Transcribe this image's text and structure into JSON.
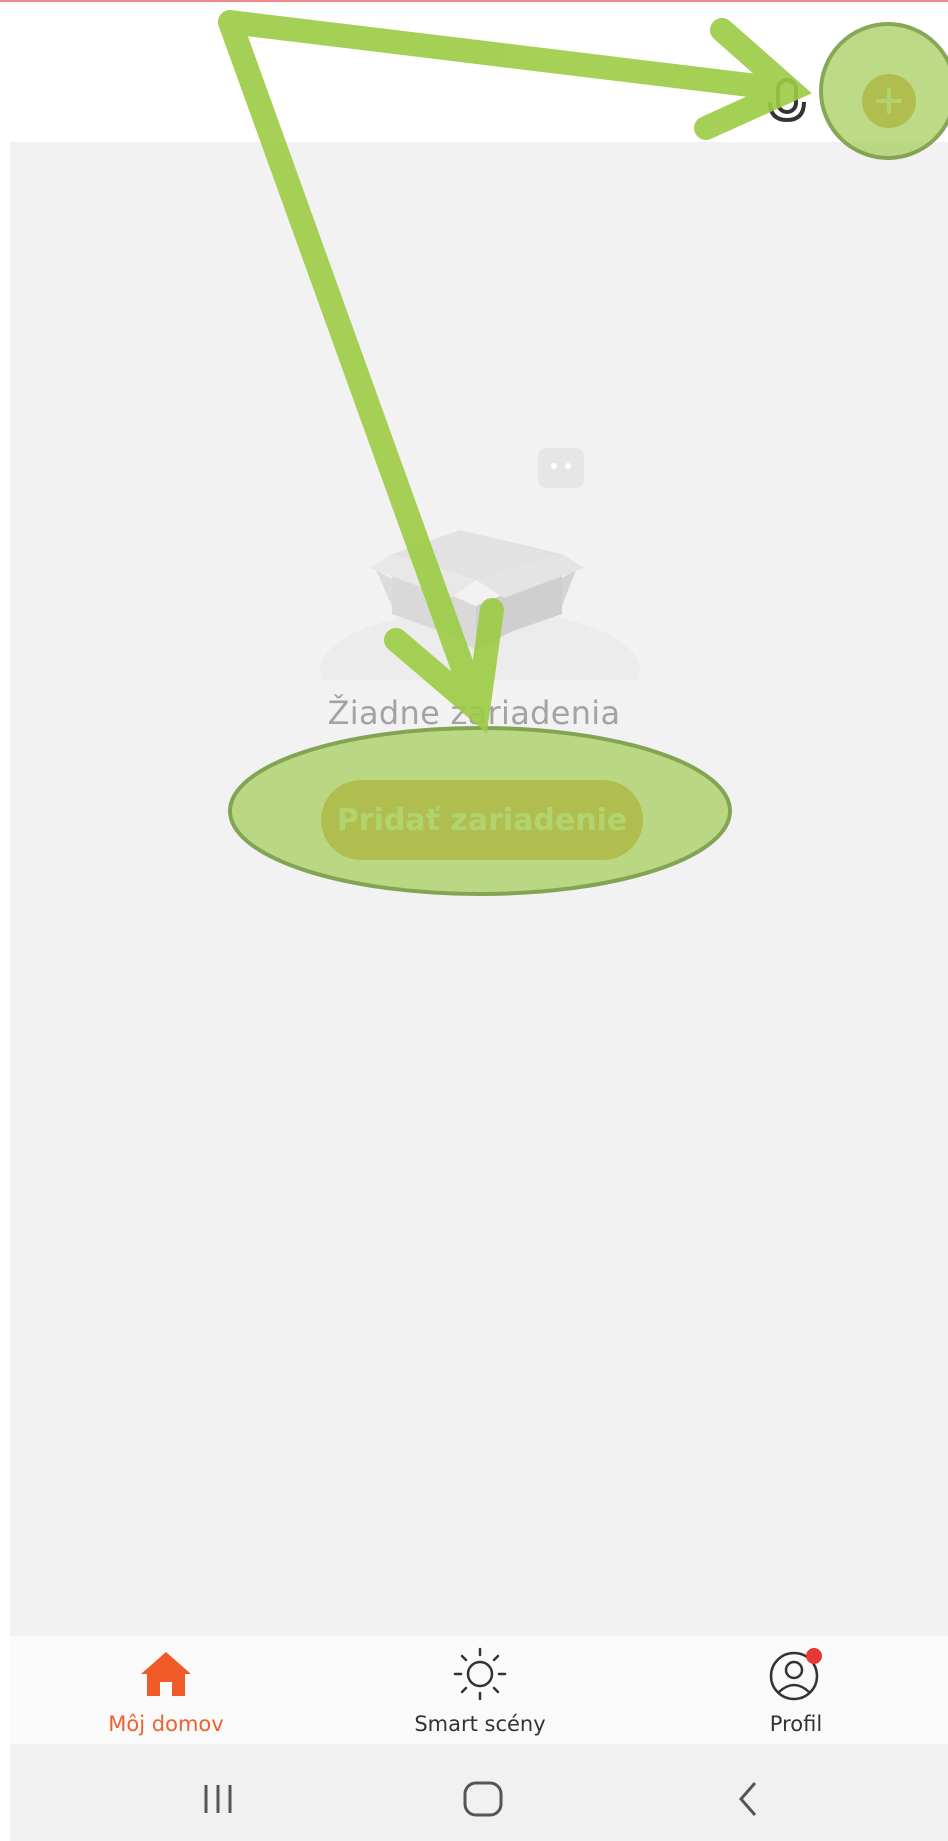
{
  "header": {
    "mic_icon": "microphone-icon",
    "add_icon": "plus-icon"
  },
  "empty_state": {
    "illustration_icon": "empty-box-icon",
    "message": "Žiadne zariadenia",
    "add_button_label": "Pridať zariadenie"
  },
  "tabs": [
    {
      "label": "Môj domov",
      "icon": "home-icon",
      "active": true
    },
    {
      "label": "Smart scény",
      "icon": "sun-icon",
      "active": false
    },
    {
      "label": "Profil",
      "icon": "profile-icon",
      "active": false,
      "badge": true
    }
  ],
  "system_nav": [
    "recent-apps-icon",
    "home-circle-icon",
    "back-icon"
  ],
  "colors": {
    "accent": "#c98a23",
    "active_tab": "#f06030",
    "annotation": "#9ccc44",
    "badge": "#e53935"
  }
}
